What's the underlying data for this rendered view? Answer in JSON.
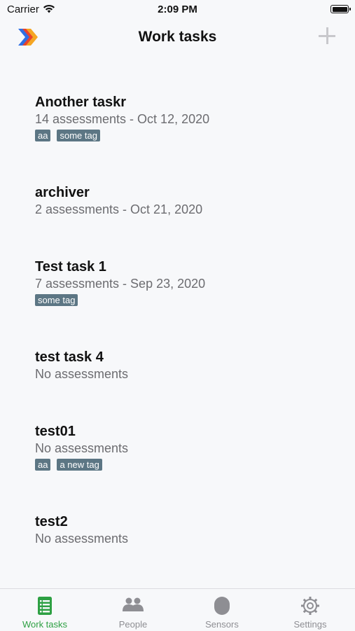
{
  "status_bar": {
    "carrier": "Carrier",
    "time": "2:09 PM"
  },
  "nav": {
    "title": "Work tasks"
  },
  "tasks": [
    {
      "title": "Another taskr",
      "subtitle": "14 assessments - Oct 12, 2020",
      "tags": [
        "aa",
        "some tag"
      ]
    },
    {
      "title": "archiver",
      "subtitle": "2 assessments - Oct 21, 2020",
      "tags": []
    },
    {
      "title": "Test task 1",
      "subtitle": "7 assessments - Sep 23, 2020",
      "tags": [
        "some tag"
      ]
    },
    {
      "title": "test task 4",
      "subtitle": "No assessments",
      "tags": []
    },
    {
      "title": "test01",
      "subtitle": "No assessments",
      "tags": [
        "aa",
        "a new tag"
      ]
    },
    {
      "title": "test2",
      "subtitle": "No assessments",
      "tags": []
    }
  ],
  "tabbar": {
    "items": [
      {
        "label": "Work tasks",
        "icon": "clipboard-list-icon",
        "active": true
      },
      {
        "label": "People",
        "icon": "people-icon",
        "active": false
      },
      {
        "label": "Sensors",
        "icon": "sensor-icon",
        "active": false
      },
      {
        "label": "Settings",
        "icon": "gear-icon",
        "active": false
      }
    ]
  },
  "colors": {
    "accent": "#2ea043",
    "tag_bg": "#5c7684",
    "inactive": "#8e8e93"
  }
}
